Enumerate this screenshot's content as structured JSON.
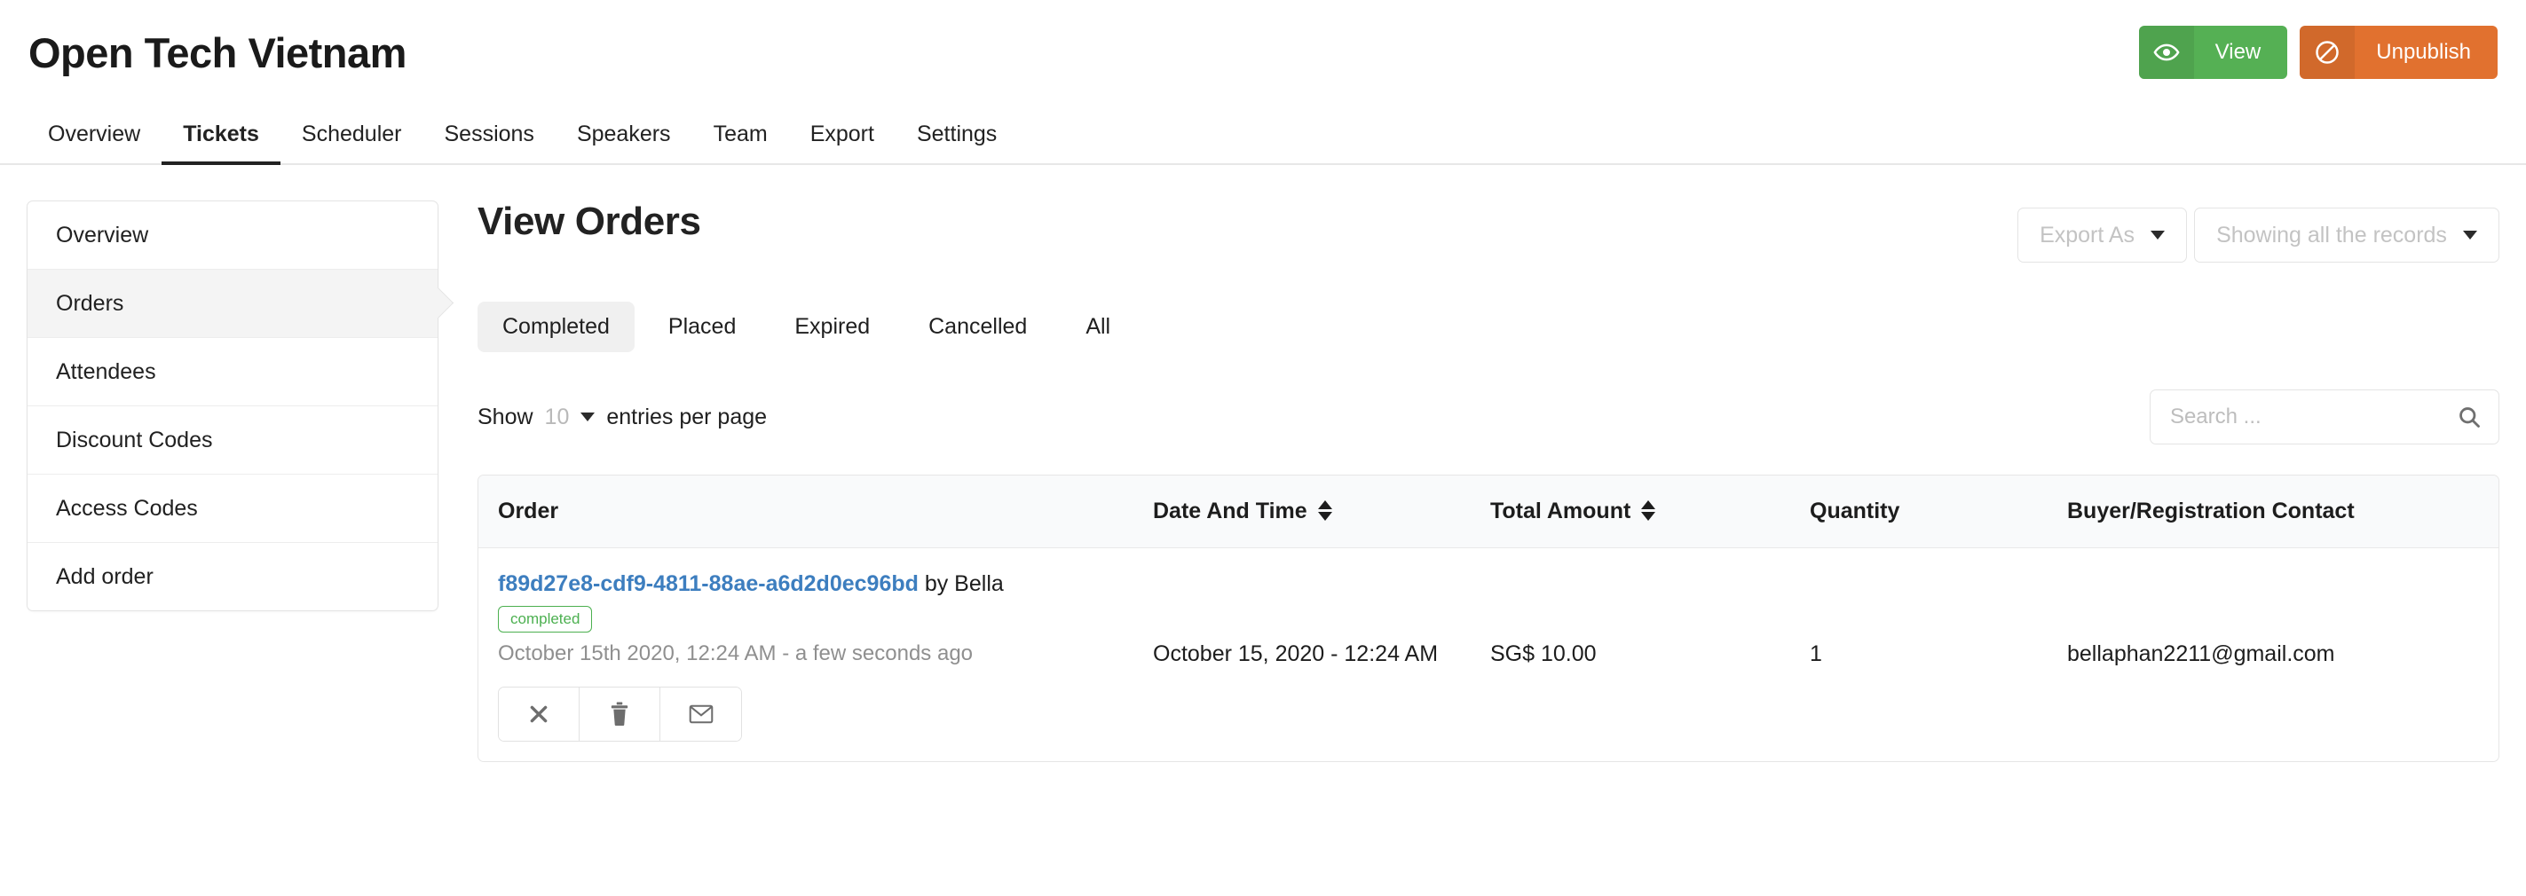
{
  "header": {
    "event_title": "Open Tech Vietnam",
    "actions": [
      {
        "label": "View",
        "icon": "eye-icon",
        "color": "#55b054"
      },
      {
        "label": "Unpublish",
        "icon": "no-entry-icon",
        "color": "#e1712f"
      }
    ]
  },
  "nav": {
    "items": [
      {
        "label": "Overview",
        "active": false
      },
      {
        "label": "Tickets",
        "active": true
      },
      {
        "label": "Scheduler",
        "active": false
      },
      {
        "label": "Sessions",
        "active": false
      },
      {
        "label": "Speakers",
        "active": false
      },
      {
        "label": "Team",
        "active": false
      },
      {
        "label": "Export",
        "active": false
      },
      {
        "label": "Settings",
        "active": false
      }
    ]
  },
  "sidebar": {
    "items": [
      {
        "label": "Overview",
        "active": false
      },
      {
        "label": "Orders",
        "active": true
      },
      {
        "label": "Attendees",
        "active": false
      },
      {
        "label": "Discount Codes",
        "active": false
      },
      {
        "label": "Access Codes",
        "active": false
      },
      {
        "label": "Add order",
        "active": false
      }
    ]
  },
  "main": {
    "title": "View Orders",
    "export_as": "Export As",
    "records_filter": "Showing all the records",
    "filters": [
      {
        "label": "Completed",
        "active": true
      },
      {
        "label": "Placed",
        "active": false
      },
      {
        "label": "Expired",
        "active": false
      },
      {
        "label": "Cancelled",
        "active": false
      },
      {
        "label": "All",
        "active": false
      }
    ],
    "show_label": "Show",
    "show_count": "10",
    "entries_label": "entries per page",
    "search_placeholder": "Search ...",
    "search_value": ""
  },
  "table": {
    "columns": {
      "order": "Order",
      "date": "Date And Time",
      "amount": "Total Amount",
      "quantity": "Quantity",
      "contact": "Buyer/Registration Contact"
    },
    "rows": [
      {
        "order_id": "f89d27e8-cdf9-4811-88ae-a6d2d0ec96bd",
        "order_by": " by Bella",
        "status": "completed",
        "timestamp": "October 15th 2020, 12:24 AM - a few seconds ago",
        "date": "October 15, 2020 - 12:24 AM",
        "amount": "SG$ 10.00",
        "quantity": "1",
        "contact": "bellaphan2211@gmail.com",
        "actions": [
          {
            "icon": "close-icon",
            "name": "cancel-order-button"
          },
          {
            "icon": "trash-icon",
            "name": "delete-order-button"
          },
          {
            "icon": "envelope-icon",
            "name": "resend-email-button"
          }
        ]
      }
    ]
  }
}
